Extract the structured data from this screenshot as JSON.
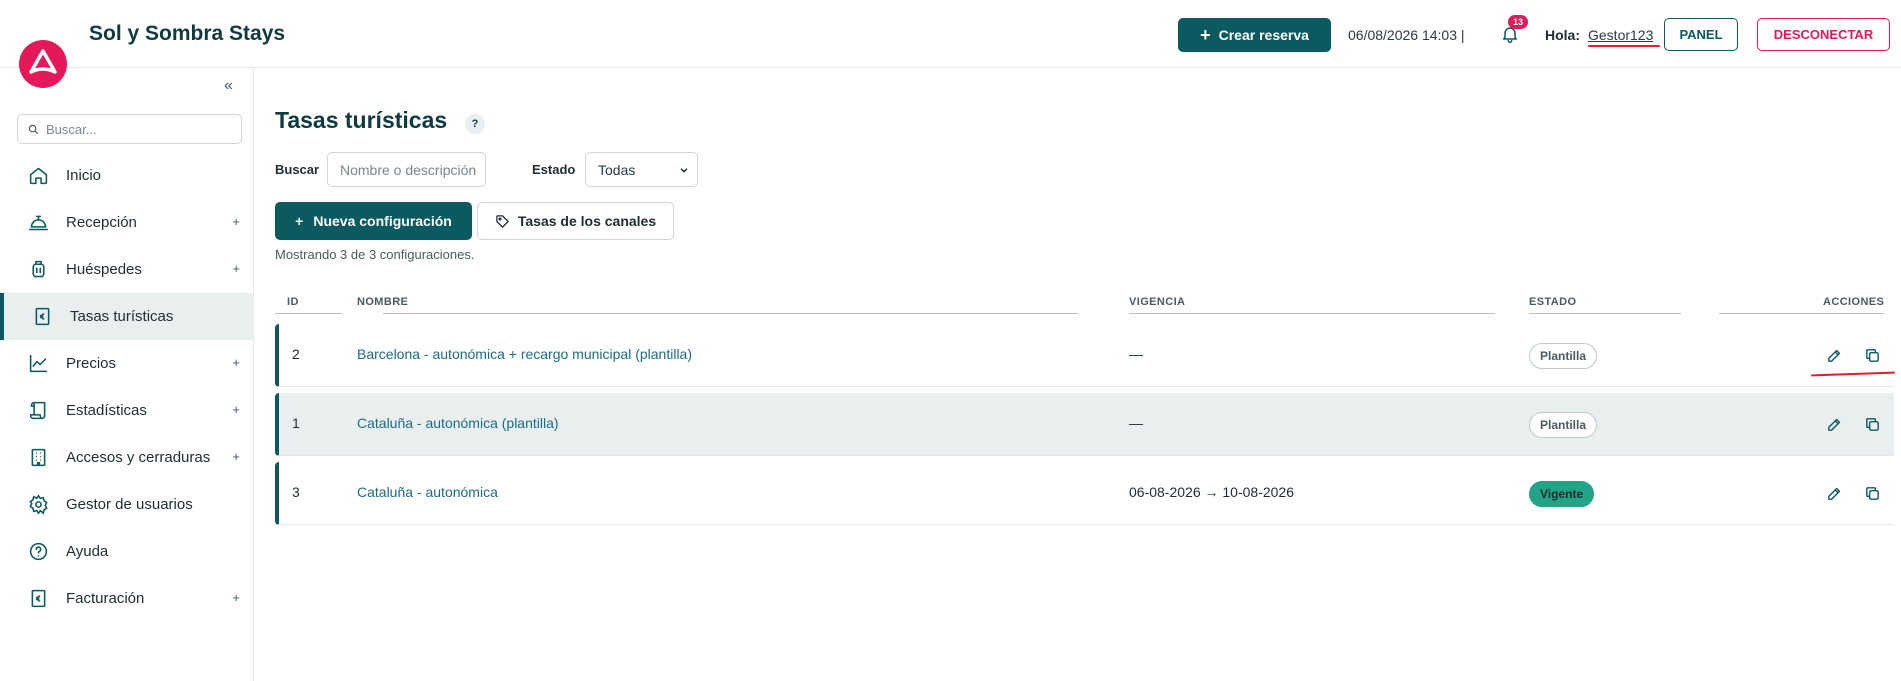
{
  "header": {
    "app_title": "Sol y Sombra Stays",
    "create_button": "Crear reserva",
    "datetime": "06/08/2026 14:03 |",
    "notification_count": "13",
    "greeting": "Hola:",
    "username": "Gestor123",
    "panel_button": "PANEL",
    "logout_button": "DESCONECTAR"
  },
  "sidebar": {
    "search_placeholder": "Buscar...",
    "items": [
      {
        "label": "Inicio",
        "icon": "home-icon",
        "expandable": false,
        "active": false
      },
      {
        "label": "Recepción",
        "icon": "bell-desk-icon",
        "expandable": true,
        "active": false
      },
      {
        "label": "Huéspedes",
        "icon": "luggage-icon",
        "expandable": true,
        "active": false
      },
      {
        "label": "Tasas turísticas",
        "icon": "euro-receipt-icon",
        "expandable": false,
        "active": true
      },
      {
        "label": "Precios",
        "icon": "chart-line-icon",
        "expandable": true,
        "active": false
      },
      {
        "label": "Estadísticas",
        "icon": "scroll-icon",
        "expandable": true,
        "active": false
      },
      {
        "label": "Accesos y cerraduras",
        "icon": "building-icon",
        "expandable": true,
        "active": false
      },
      {
        "label": "Gestor de usuarios",
        "icon": "gear-icon",
        "expandable": false,
        "active": false
      },
      {
        "label": "Ayuda",
        "icon": "question-icon",
        "expandable": false,
        "active": false
      },
      {
        "label": "Facturación",
        "icon": "euro-receipt-icon",
        "expandable": true,
        "active": false
      }
    ]
  },
  "main": {
    "title": "Tasas turísticas",
    "help": "?",
    "filters": {
      "search_label": "Buscar",
      "search_placeholder": "Nombre o descripción",
      "state_label": "Estado",
      "state_value": "Todas"
    },
    "new_button": "Nueva configuración",
    "channels_button": "Tasas de los canales",
    "showing": "Mostrando 3 de 3 configuraciones.",
    "table": {
      "headers": {
        "id": "ID",
        "name": "NOMBRE",
        "validity": "VIGENCIA",
        "state": "ESTADO",
        "actions": "ACCIONES"
      },
      "rows": [
        {
          "id": "2",
          "name": "Barcelona - autonómica + recargo municipal (plantilla)",
          "validity": "—",
          "state": "Plantilla",
          "state_type": "plantilla"
        },
        {
          "id": "1",
          "name": "Cataluña - autonómica (plantilla)",
          "validity": "—",
          "state": "Plantilla",
          "state_type": "plantilla"
        },
        {
          "id": "3",
          "name": "Cataluña - autonómica",
          "validity": "06-08-2026 → 10-08-2026",
          "state": "Vigente",
          "state_type": "vigente"
        }
      ]
    }
  },
  "colors": {
    "primary": "#0b5a5f",
    "accent": "#e5195a",
    "success": "#21a487",
    "annotation": "#e0202a"
  }
}
